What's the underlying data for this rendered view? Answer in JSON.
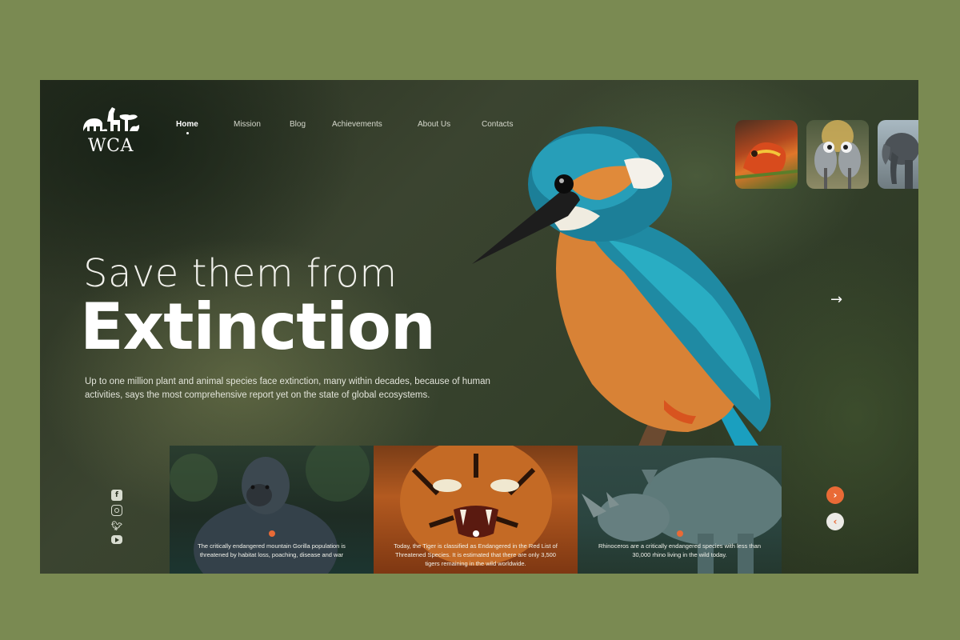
{
  "brand": {
    "logo_text": "WCA"
  },
  "nav": {
    "items": [
      "Home",
      "Mission",
      "Blog",
      "Achievements",
      "About Us",
      "Contacts"
    ],
    "active": "Home"
  },
  "hero": {
    "subtitle": "Save them from",
    "title": "Extinction",
    "description": "Up to one million plant and animal species face extinction, many within decades, because of human activities, says the most comprehensive report yet on the state of global ecosystems."
  },
  "thumbnails": [
    "chameleon",
    "crowned cranes",
    "elephant"
  ],
  "cards": [
    {
      "animal": "gorilla",
      "text": "The critically endangered mountain Gorilla population is threatened by habitat loss, poaching, disease and war",
      "dot_color": "#e96a36"
    },
    {
      "animal": "tiger",
      "text": "Today, the Tiger is classified as Endangered in the Red List of Threatened Species. It is estimated that there are only 3,500 tigers remaining in the wild worldwide.",
      "dot_color": "#ffffff"
    },
    {
      "animal": "rhino",
      "text": "Rhinoceros are a critically endangered species with less than 30,000 rhino living in the wild today.",
      "dot_color": "#e96a36"
    }
  ],
  "social": [
    "facebook-icon",
    "instagram-icon",
    "twitter-icon",
    "youtube-icon"
  ],
  "controls": {
    "next": "›",
    "prev": "‹",
    "arrow": "→"
  },
  "colors": {
    "accent": "#e96a36",
    "page_bg": "#7a8a52",
    "hero_bg": "#333d29"
  }
}
